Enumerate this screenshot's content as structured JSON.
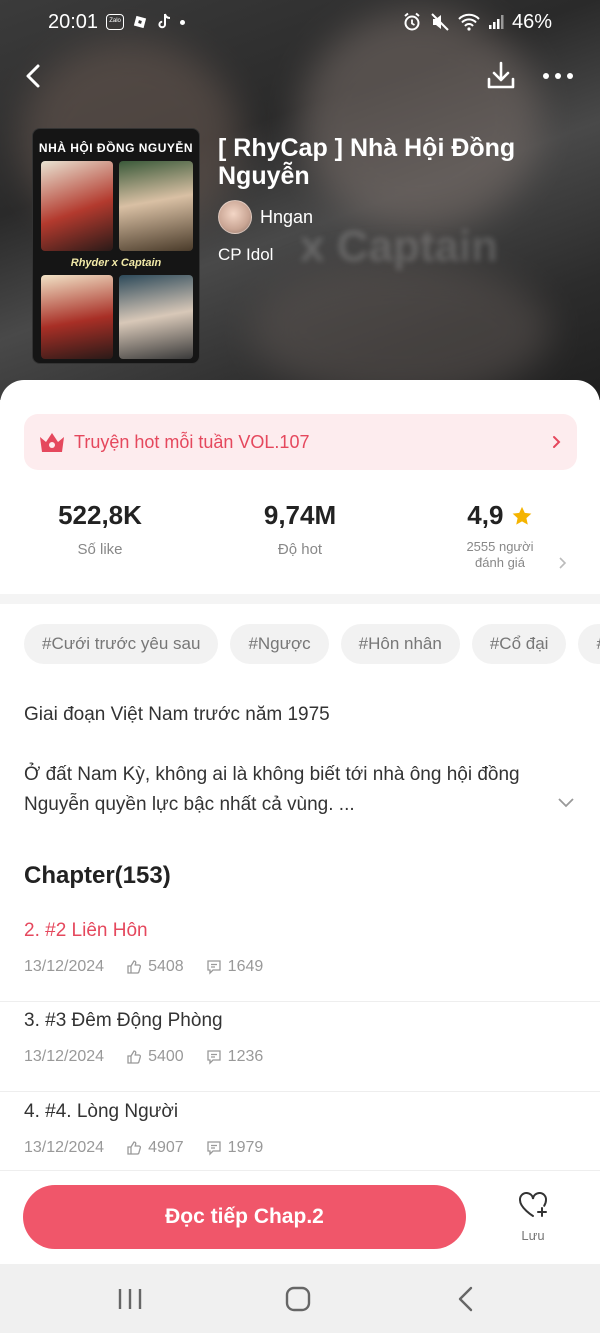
{
  "status_bar": {
    "time": "20:01",
    "left_icons": [
      "zalo-icon",
      "roblox-icon",
      "tiktok-icon"
    ],
    "battery": "46%"
  },
  "comic": {
    "title": "[ RhyCap ] Nhà Hội Đồng Nguyễn",
    "author": "Hngan",
    "category": "CP Idol",
    "cover": {
      "header": "NHÀ HỘI ĐỒNG NGUYỄN",
      "subtitle": "Rhyder x Captain"
    },
    "hero_text": "x Captain"
  },
  "hot_banner": {
    "label": "Truyện hot mỗi tuần VOL.107"
  },
  "stats": {
    "likes": {
      "value": "522,8K",
      "label": "Số like"
    },
    "hot": {
      "value": "9,74M",
      "label": "Độ hot"
    },
    "rating": {
      "value": "4,9",
      "label_line1": "2555 người",
      "label_line2": "đánh giá"
    }
  },
  "tags": [
    "#Cưới trước yêu sau",
    "#Ngược",
    "#Hôn nhân",
    "#Cổ đại",
    "#"
  ],
  "description": {
    "line1": "Giai đoạn Việt Nam trước năm 1975",
    "line2": "Ở đất Nam Kỳ, không ai là không biết tới nhà ông hội đồng Nguyễn quyền lực bậc nhất cả vùng. ..."
  },
  "chapters_header": "Chapter(153)",
  "chapters": [
    {
      "title": "2. #2 Liên Hôn",
      "date": "13/12/2024",
      "likes": "5408",
      "comments": "1649",
      "active": true
    },
    {
      "title": "3. #3 Đêm Động Phòng",
      "date": "13/12/2024",
      "likes": "5400",
      "comments": "1236",
      "active": false
    },
    {
      "title": "4. #4. Lòng Người",
      "date": "13/12/2024",
      "likes": "4907",
      "comments": "1979",
      "active": false
    }
  ],
  "actions": {
    "continue_label": "Đọc tiếp Chap.2",
    "save_label": "Lưu"
  },
  "colors": {
    "accent": "#f0566a",
    "accent_text": "#e5485d",
    "banner_bg": "#fdecee",
    "star": "#f5b400"
  }
}
